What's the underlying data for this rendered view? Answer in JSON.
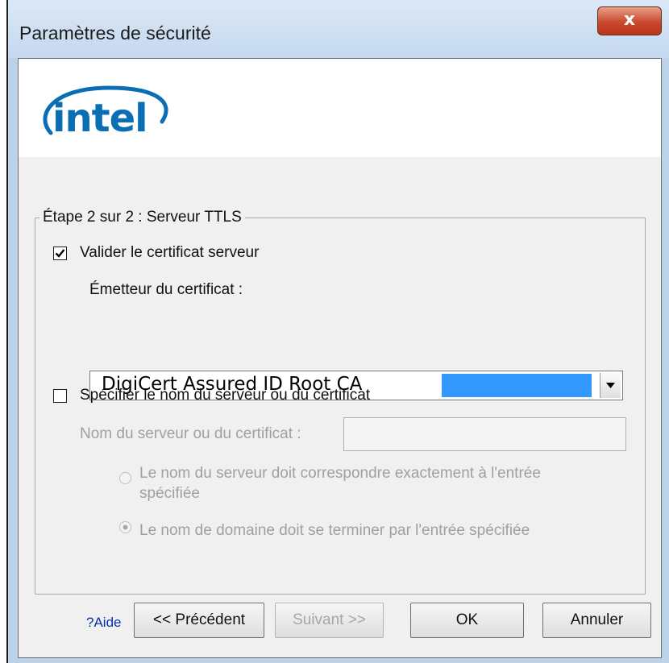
{
  "window": {
    "title": "Paramètres de sécurité",
    "close_glyph": "x"
  },
  "logo": {
    "text": "intel"
  },
  "group": {
    "legend": "Étape 2 sur 2 : Serveur TTLS"
  },
  "validate_cert": {
    "label": "Valider le certificat serveur",
    "checked": true
  },
  "issuer": {
    "label": "Émetteur du certificat :",
    "selected": "DigiCert Assured ID Root CA"
  },
  "specify_server": {
    "label": "Spécifier le nom du serveur ou du certificat",
    "checked": false
  },
  "server_name": {
    "label": "Nom du serveur ou du certificat :",
    "value": ""
  },
  "match_options": {
    "exact_line1": "Le nom du serveur doit correspondre exactement à l'entrée",
    "exact_line2": "spécifiée",
    "domain": "Le nom de domaine doit se terminer par l'entrée spécifiée",
    "selected": "domain"
  },
  "buttons": {
    "help": "?Aide",
    "previous": "<< Précédent",
    "next": "Suivant >>",
    "ok": "OK",
    "cancel": "Annuler"
  },
  "colors": {
    "intel_blue": "#0a6eb4",
    "selection": "#3399ff",
    "link": "#0033aa"
  }
}
